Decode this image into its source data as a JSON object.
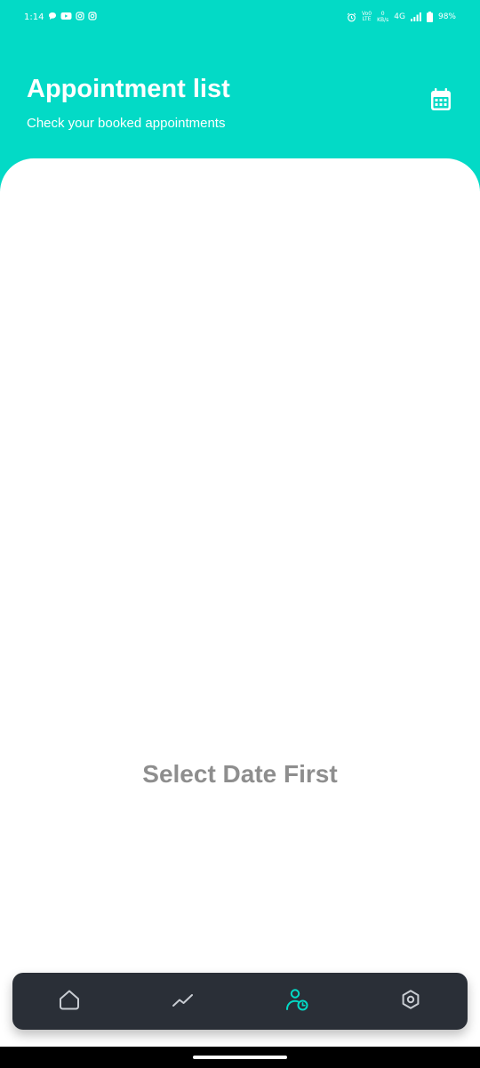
{
  "status_bar": {
    "time": "1:14",
    "volte_top": "Vo0",
    "volte_bottom": "LTE",
    "net_speed_value": "0",
    "net_speed_unit": "KB/s",
    "network": "4G",
    "battery": "98%",
    "left_icons": [
      "chat-icon",
      "youtube-icon",
      "instagram-icon",
      "instagram-icon"
    ],
    "right_icons": [
      "alarm-icon",
      "signal-icon",
      "battery-icon"
    ]
  },
  "header": {
    "title": "Appointment list",
    "subtitle": "Check your booked appointments",
    "action_icon": "calendar-icon"
  },
  "main": {
    "empty_message": "Select Date First"
  },
  "bottom_nav": {
    "items": [
      {
        "icon": "home-icon",
        "active": false
      },
      {
        "icon": "trend-icon",
        "active": false
      },
      {
        "icon": "user-clock-icon",
        "active": true
      },
      {
        "icon": "settings-icon",
        "active": false
      }
    ]
  },
  "colors": {
    "accent": "#03dac6",
    "nav_background": "#2a2f37",
    "nav_icon_inactive": "#c8ccd2",
    "nav_icon_active": "#03dac6",
    "empty_message_text": "#8e8e8e"
  }
}
